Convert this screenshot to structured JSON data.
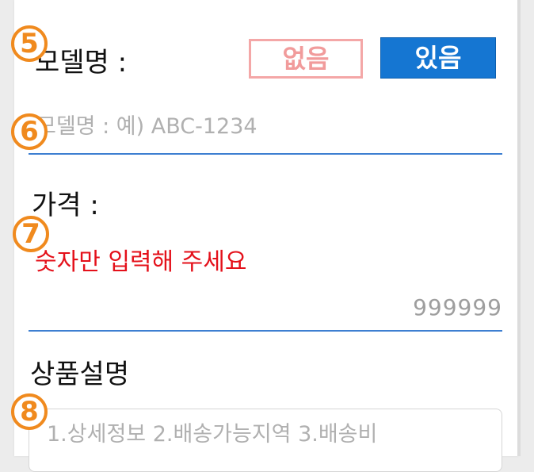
{
  "badges": {
    "model": "5",
    "model_input": "6",
    "price": "7",
    "description": "8"
  },
  "model": {
    "label": "모델명 :",
    "option_none": "없음",
    "option_yes": "있음",
    "input_placeholder": "모델명 : 예) ABC-1234"
  },
  "price": {
    "label": "가격 :",
    "warning": "숫자만 입력해 주세요",
    "input_value": "999999"
  },
  "description": {
    "label": "상품설명",
    "placeholder": "1.상세정보 2.배송가능지역 3.배송비"
  },
  "colors": {
    "badge": "#f08a1e",
    "accent_blue": "#1576d2",
    "none_option": "#f19b9b",
    "warning": "#e4101a",
    "underline": "#3d7fd1"
  }
}
